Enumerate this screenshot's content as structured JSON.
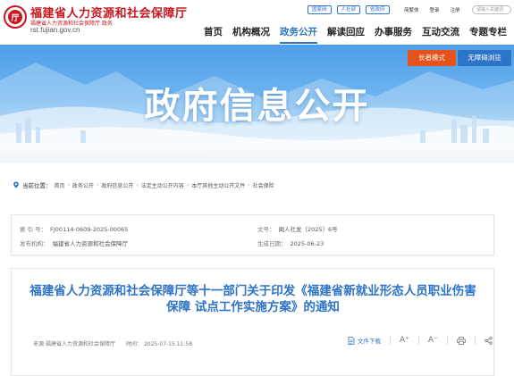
{
  "header": {
    "logo_glyph": "厅",
    "site_title": "福建省人力资源和社会保障厅",
    "site_subtitle": "福建省人力资源和社会保障厅 政务",
    "site_url": "rst.fujian.gov.cn",
    "top_pills": [
      "国家网",
      "人社部",
      "省政府"
    ],
    "util_links": [
      "简繁体",
      "登录",
      "注册"
    ],
    "search_placeholder": "请输入关键词"
  },
  "nav": {
    "items": [
      "首页",
      "机构概况",
      "政务公开",
      "解读回应",
      "办事服务",
      "互动交流",
      "专题专栏"
    ],
    "active_index": 2
  },
  "banner": {
    "title": "政府信息公开",
    "elder_mode": "长者模式",
    "accessibility": "无障碍浏览"
  },
  "breadcrumb": {
    "label": "当前位置：",
    "items": [
      "首页",
      "政务公开",
      "政府信息公开",
      "法定主动公开内容",
      "本厅其他主动公开文件",
      "社会保险"
    ]
  },
  "meta": {
    "index_label": "索 引 号：",
    "index_value": "FJ00114-0609-2025-00065",
    "doc_label": "文号：",
    "doc_value": "闽人社发〔2025〕6号",
    "publisher_label": "发布机构：",
    "publisher_value": "福建省人力资源和社会保障厅",
    "date_label": "生成日期：",
    "date_value": "2025-06-23"
  },
  "article": {
    "title": "福建省人力资源和社会保障厅等十一部门关于印发《福建省新就业形态人员职业伤害保障 试点工作实施方案》的通知",
    "source": "来源:福建省人力资源和社会保障厅",
    "time": "时间： 2025-07-15 11:58",
    "download_label": "文件下载",
    "font_up": "A⁺",
    "font_down": "A⁻"
  },
  "colors": {
    "brand_red": "#c8161d",
    "accent_blue": "#2d73c6",
    "elder_orange": "#e5531a"
  }
}
